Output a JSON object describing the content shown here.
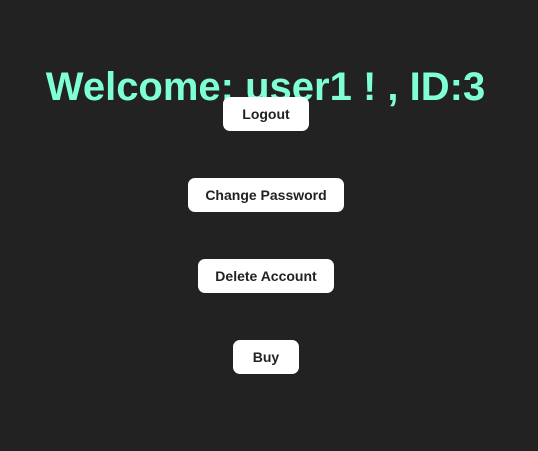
{
  "header": {
    "welcome_text": "Welcome: user1 ! , ID:3"
  },
  "actions": {
    "logout_label": "Logout",
    "change_password_label": "Change Password",
    "delete_account_label": "Delete Account",
    "buy_label": "Buy"
  },
  "colors": {
    "background": "#222222",
    "welcome_accent": "#7fffd4",
    "button_background": "#ffffff",
    "button_text": "#222222"
  }
}
